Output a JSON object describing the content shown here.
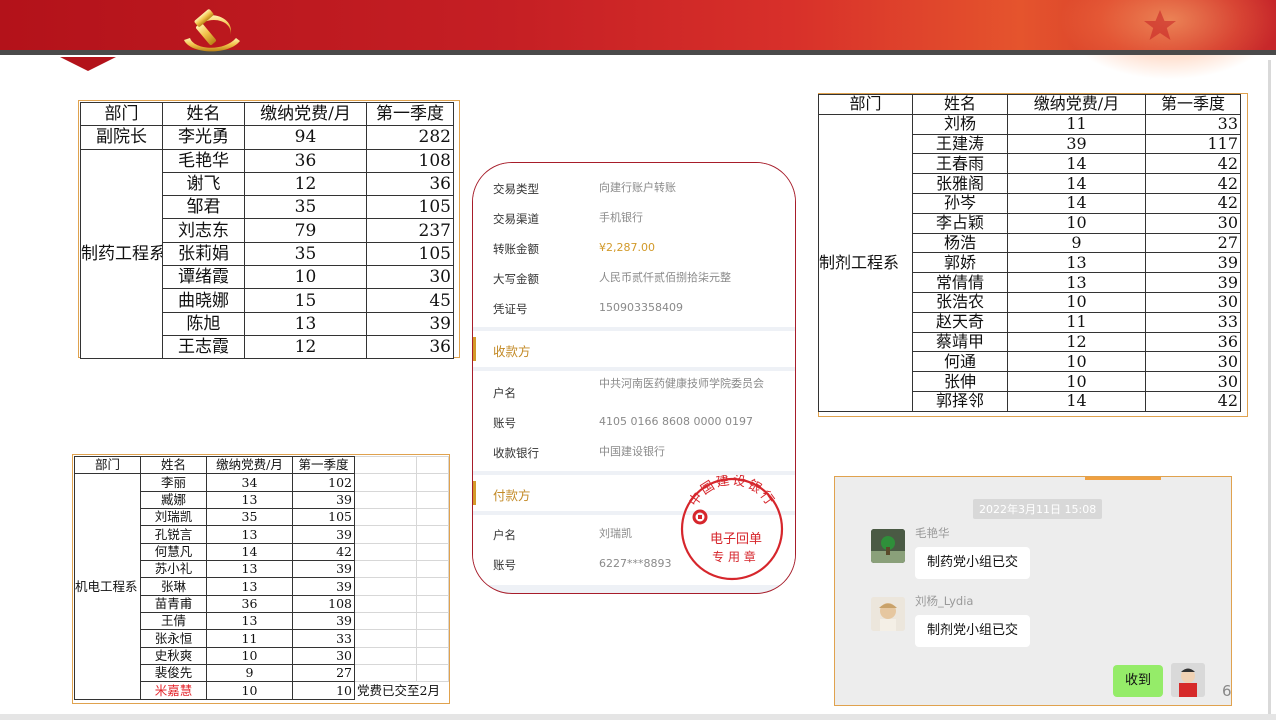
{
  "table1": {
    "headers": [
      "部门",
      "姓名",
      "缴纳党费/月",
      "第一季度"
    ],
    "rows": [
      {
        "dept": "副院长",
        "name": "李光勇",
        "monthly": "94",
        "q1": "282"
      },
      {
        "dept": "",
        "name": "毛艳华",
        "monthly": "36",
        "q1": "108"
      },
      {
        "dept": "",
        "name": "谢飞",
        "monthly": "12",
        "q1": "36"
      },
      {
        "dept": "",
        "name": "邹君",
        "monthly": "35",
        "q1": "105"
      },
      {
        "dept": "",
        "name": "刘志东",
        "monthly": "79",
        "q1": "237"
      },
      {
        "dept": "",
        "name": "张莉娟",
        "monthly": "35",
        "q1": "105"
      },
      {
        "dept": "",
        "name": "谭绪霞",
        "monthly": "10",
        "q1": "30"
      },
      {
        "dept": "",
        "name": "曲晓娜",
        "monthly": "15",
        "q1": "45"
      },
      {
        "dept": "",
        "name": "陈旭",
        "monthly": "13",
        "q1": "39"
      },
      {
        "dept": "",
        "name": "王志霞",
        "monthly": "12",
        "q1": "36"
      }
    ],
    "group_dept": "制药工程系"
  },
  "table2": {
    "headers": [
      "部门",
      "姓名",
      "缴纳党费/月",
      "第一季度"
    ],
    "group_dept": "制剂工程系",
    "rows": [
      {
        "name": "刘杨",
        "monthly": "11",
        "q1": "33"
      },
      {
        "name": "王建涛",
        "monthly": "39",
        "q1": "117"
      },
      {
        "name": "王春雨",
        "monthly": "14",
        "q1": "42"
      },
      {
        "name": "张雅阁",
        "monthly": "14",
        "q1": "42"
      },
      {
        "name": "孙岑",
        "monthly": "14",
        "q1": "42"
      },
      {
        "name": "李占颖",
        "monthly": "10",
        "q1": "30"
      },
      {
        "name": "杨浩",
        "monthly": "9",
        "q1": "27"
      },
      {
        "name": "郭娇",
        "monthly": "13",
        "q1": "39"
      },
      {
        "name": "常倩倩",
        "monthly": "13",
        "q1": "39"
      },
      {
        "name": "张浩农",
        "monthly": "10",
        "q1": "30"
      },
      {
        "name": "赵天奇",
        "monthly": "11",
        "q1": "33"
      },
      {
        "name": "蔡靖甲",
        "monthly": "12",
        "q1": "36"
      },
      {
        "name": "何通",
        "monthly": "10",
        "q1": "30"
      },
      {
        "name": "张伸",
        "monthly": "10",
        "q1": "30"
      },
      {
        "name": "郭择邻",
        "monthly": "14",
        "q1": "42"
      }
    ]
  },
  "table3": {
    "headers": [
      "部门",
      "姓名",
      "缴纳党费/月",
      "第一季度"
    ],
    "group_dept": "机电工程系",
    "note": "党费已交至2月",
    "rows": [
      {
        "name": "李丽",
        "monthly": "34",
        "q1": "102"
      },
      {
        "name": "臧娜",
        "monthly": "13",
        "q1": "39"
      },
      {
        "name": "刘瑞凯",
        "monthly": "35",
        "q1": "105"
      },
      {
        "name": "孔锐言",
        "monthly": "13",
        "q1": "39"
      },
      {
        "name": "何慧凡",
        "monthly": "14",
        "q1": "42"
      },
      {
        "name": "苏小礼",
        "monthly": "13",
        "q1": "39"
      },
      {
        "name": "张琳",
        "monthly": "13",
        "q1": "39"
      },
      {
        "name": "苗青甫",
        "monthly": "36",
        "q1": "108"
      },
      {
        "name": "王倩",
        "monthly": "13",
        "q1": "39"
      },
      {
        "name": "张永恒",
        "monthly": "11",
        "q1": "33"
      },
      {
        "name": "史秋爽",
        "monthly": "10",
        "q1": "30"
      },
      {
        "name": "裴俊先",
        "monthly": "9",
        "q1": "27"
      },
      {
        "name": "米嘉慧",
        "monthly": "10",
        "q1": "10"
      }
    ]
  },
  "receipt": {
    "rows": [
      {
        "label": "交易类型",
        "value": "向建行账户转账"
      },
      {
        "label": "交易渠道",
        "value": "手机银行"
      },
      {
        "label": "转账金额",
        "value": "¥2,287.00"
      },
      {
        "label": "大写金额",
        "value": "人民币贰仟贰佰捌拾柒元整"
      },
      {
        "label": "凭证号",
        "value": "150903358409"
      }
    ],
    "payee_title": "收款方",
    "payee": [
      {
        "label": "户名",
        "value": "中共河南医药健康技师学院委员会"
      },
      {
        "label": "账号",
        "value": "4105 0166 8608 0000 0197"
      },
      {
        "label": "收款银行",
        "value": "中国建设银行"
      }
    ],
    "payer_title": "付款方",
    "payer": [
      {
        "label": "户名",
        "value": "刘瑞凯"
      },
      {
        "label": "账号",
        "value": "6227***8893"
      }
    ],
    "stamp": {
      "arc_text": "中国建设银行",
      "line1": "电子回单",
      "line2": "专 用 章",
      "color": "#d6262c"
    }
  },
  "chat": {
    "timestamp": "2022年3月11日 15:08",
    "messages": [
      {
        "sender": "毛艳华",
        "text": "制药党小组已交"
      },
      {
        "sender": "刘杨_Lydia",
        "text": "制剂党小组已交"
      }
    ],
    "reply": "收到",
    "bubble_color_self": "#95ec69"
  },
  "page_number": "6",
  "colors": {
    "banner_red": "#b3121a",
    "frame_orange": "#e0a24e",
    "receipt_border": "#a71d2a",
    "accent_gold": "#d29a2a"
  }
}
